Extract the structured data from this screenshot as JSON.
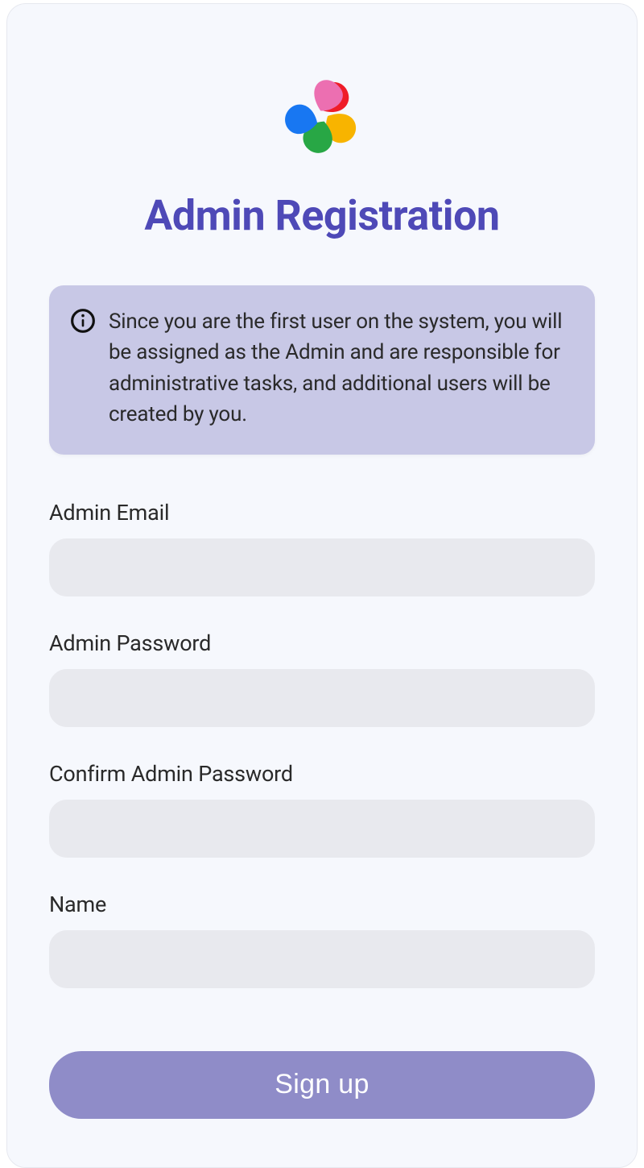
{
  "page": {
    "title": "Admin Registration"
  },
  "info": {
    "message": "Since you are the first user on the system, you will be assigned as the Admin and are responsible for administrative tasks, and additional users will be created by you."
  },
  "fields": {
    "email": {
      "label": "Admin Email",
      "value": "",
      "placeholder": ""
    },
    "password": {
      "label": "Admin Password",
      "value": "",
      "placeholder": ""
    },
    "confirm": {
      "label": "Confirm Admin Password",
      "value": "",
      "placeholder": ""
    },
    "name": {
      "label": "Name",
      "value": "",
      "placeholder": ""
    }
  },
  "actions": {
    "submit_label": "Sign up"
  }
}
